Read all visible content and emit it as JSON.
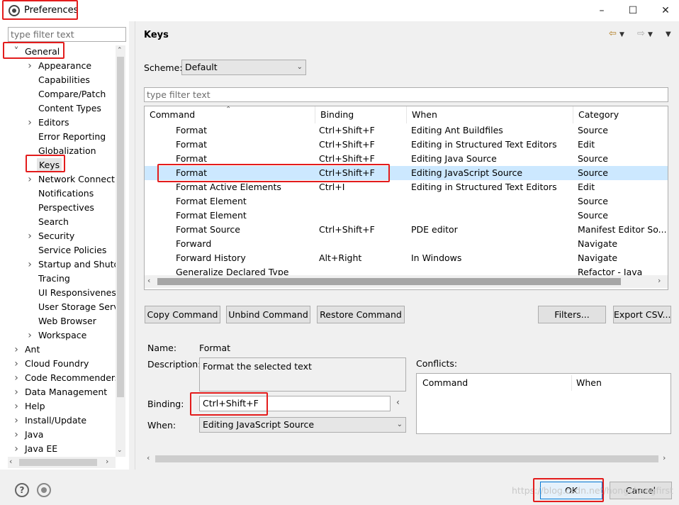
{
  "window": {
    "title": "Preferences",
    "minimize_icon": "minimize-icon",
    "maximize_icon": "maximize-icon",
    "close_icon": "close-icon"
  },
  "left": {
    "filter_placeholder": "type filter text",
    "tree": [
      {
        "label": "General",
        "expanded": true,
        "level": 0
      },
      {
        "label": "Appearance",
        "arrow": true,
        "level": 1
      },
      {
        "label": "Capabilities",
        "level": 1
      },
      {
        "label": "Compare/Patch",
        "level": 1
      },
      {
        "label": "Content Types",
        "level": 1
      },
      {
        "label": "Editors",
        "arrow": true,
        "level": 1
      },
      {
        "label": "Error Reporting",
        "level": 1
      },
      {
        "label": "Globalization",
        "level": 1
      },
      {
        "label": "Keys",
        "level": 1,
        "selected": true
      },
      {
        "label": "Network Connecti",
        "arrow": true,
        "level": 1
      },
      {
        "label": "Notifications",
        "level": 1
      },
      {
        "label": "Perspectives",
        "level": 1
      },
      {
        "label": "Search",
        "level": 1
      },
      {
        "label": "Security",
        "arrow": true,
        "level": 1
      },
      {
        "label": "Service Policies",
        "level": 1
      },
      {
        "label": "Startup and Shutd",
        "arrow": true,
        "level": 1
      },
      {
        "label": "Tracing",
        "level": 1
      },
      {
        "label": "UI Responsiveness",
        "level": 1
      },
      {
        "label": "User Storage Serv",
        "level": 1
      },
      {
        "label": "Web Browser",
        "level": 1
      },
      {
        "label": "Workspace",
        "arrow": true,
        "level": 1
      },
      {
        "label": "Ant",
        "arrow": true,
        "level": 0
      },
      {
        "label": "Cloud Foundry",
        "arrow": true,
        "level": 0
      },
      {
        "label": "Code Recommenders",
        "arrow": true,
        "level": 0
      },
      {
        "label": "Data Management",
        "arrow": true,
        "level": 0
      },
      {
        "label": "Help",
        "arrow": true,
        "level": 0
      },
      {
        "label": "Install/Update",
        "arrow": true,
        "level": 0
      },
      {
        "label": "Java",
        "arrow": true,
        "level": 0
      },
      {
        "label": "Java EE",
        "arrow": true,
        "level": 0
      }
    ]
  },
  "right": {
    "title": "Keys",
    "scheme_label": "Scheme:",
    "scheme_value": "Default",
    "filter_placeholder": "type filter text",
    "columns": [
      "Command",
      "Binding",
      "When",
      "Category"
    ],
    "rows": [
      [
        "Format",
        "Ctrl+Shift+F",
        "Editing Ant Buildfiles",
        "Source"
      ],
      [
        "Format",
        "Ctrl+Shift+F",
        "Editing in Structured Text Editors",
        "Edit"
      ],
      [
        "Format",
        "Ctrl+Shift+F",
        "Editing Java Source",
        "Source"
      ],
      [
        "Format",
        "Ctrl+Shift+F",
        "Editing JavaScript Source",
        "Source"
      ],
      [
        "Format Active Elements",
        "Ctrl+I",
        "Editing in Structured Text Editors",
        "Edit"
      ],
      [
        "Format Element",
        "",
        "",
        "Source"
      ],
      [
        "Format Element",
        "",
        "",
        "Source"
      ],
      [
        "Format Source",
        "Ctrl+Shift+F",
        "PDE editor",
        "Manifest Editor So..."
      ],
      [
        "Forward",
        "",
        "",
        "Navigate"
      ],
      [
        "Forward History",
        "Alt+Right",
        "In Windows",
        "Navigate"
      ],
      [
        "Generalize Declared Type",
        "",
        "",
        "Refactor - Java"
      ]
    ],
    "selected_row": 3,
    "buttons": {
      "copy": "Copy Command",
      "unbind": "Unbind Command",
      "restore": "Restore Command",
      "filters": "Filters...",
      "export": "Export CSV..."
    },
    "details": {
      "name_label": "Name:",
      "name_value": "Format",
      "desc_label": "Description:",
      "desc_value": "Format the selected text",
      "binding_label": "Binding:",
      "binding_value": "Ctrl+Shift+F",
      "when_label": "When:",
      "when_value": "Editing JavaScript Source",
      "conflicts_label": "Conflicts:",
      "conflicts_columns": [
        "Command",
        "When"
      ]
    }
  },
  "bottom": {
    "ok": "OK",
    "cancel": "Cancel",
    "watermark": "https://blog.csdn.net/hongchangfirst"
  }
}
